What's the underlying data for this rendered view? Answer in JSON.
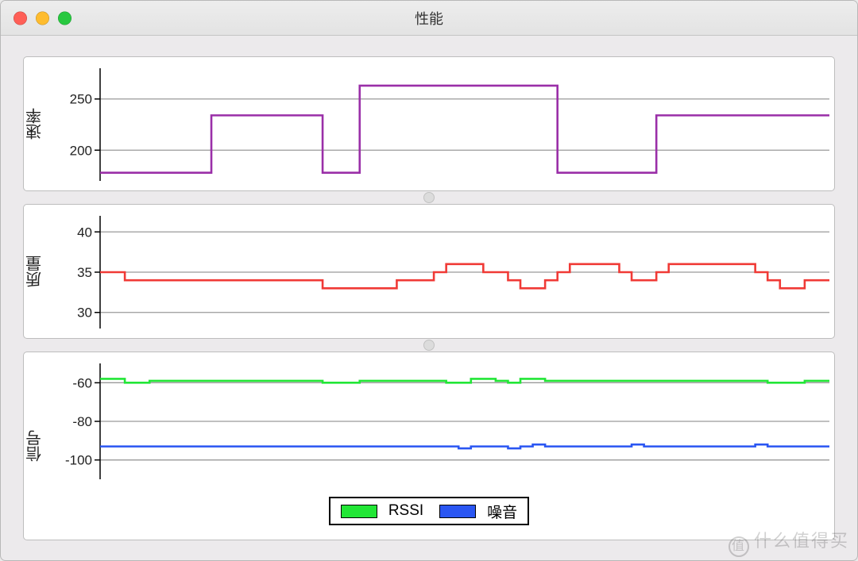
{
  "window_title": "性能",
  "panels": {
    "rate": {
      "label": "速率"
    },
    "quality": {
      "label": "质量"
    },
    "signal": {
      "label": "信号"
    }
  },
  "legend": {
    "rssi": {
      "label": "RSSI",
      "color": "#22e636"
    },
    "noise": {
      "label": "噪音",
      "color": "#2a56f2"
    }
  },
  "colors": {
    "rate_line": "#9a2fa8",
    "quality_line": "#f03a36",
    "rssi_line": "#22e636",
    "noise_line": "#2a56f2",
    "grid": "#9a9a9a"
  },
  "watermark": "什么值得买",
  "chart_data": [
    {
      "type": "line",
      "title": "速率",
      "xlabel": "",
      "ylabel": "速率",
      "ylim": [
        170,
        280
      ],
      "yticks": [
        200,
        250
      ],
      "x_range": [
        0,
        59
      ],
      "series": [
        {
          "name": "速率",
          "color": "#9a2fa8",
          "values": [
            178,
            178,
            178,
            178,
            178,
            178,
            178,
            178,
            178,
            234,
            234,
            234,
            234,
            234,
            234,
            234,
            234,
            234,
            178,
            178,
            178,
            263,
            263,
            263,
            263,
            263,
            263,
            263,
            263,
            263,
            263,
            263,
            263,
            263,
            263,
            263,
            263,
            178,
            178,
            178,
            178,
            178,
            178,
            178,
            178,
            234,
            234,
            234,
            234,
            234,
            234,
            234,
            234,
            234,
            234,
            234,
            234,
            234,
            234,
            234
          ]
        }
      ]
    },
    {
      "type": "line",
      "title": "质量",
      "xlabel": "",
      "ylabel": "质量",
      "ylim": [
        28,
        42
      ],
      "yticks": [
        30,
        35,
        40
      ],
      "x_range": [
        0,
        59
      ],
      "series": [
        {
          "name": "质量",
          "color": "#f03a36",
          "values": [
            35,
            35,
            34,
            34,
            34,
            34,
            34,
            34,
            34,
            34,
            34,
            34,
            34,
            34,
            34,
            34,
            34,
            34,
            33,
            33,
            33,
            33,
            33,
            33,
            34,
            34,
            34,
            35,
            36,
            36,
            36,
            35,
            35,
            34,
            33,
            33,
            34,
            35,
            36,
            36,
            36,
            36,
            35,
            34,
            34,
            35,
            36,
            36,
            36,
            36,
            36,
            36,
            36,
            35,
            34,
            33,
            33,
            34,
            34,
            34
          ]
        }
      ]
    },
    {
      "type": "line",
      "title": "信号",
      "xlabel": "",
      "ylabel": "信号",
      "ylim": [
        -110,
        -50
      ],
      "yticks": [
        -100,
        -80,
        -60
      ],
      "x_range": [
        0,
        59
      ],
      "legend_position": "bottom",
      "series": [
        {
          "name": "RSSI",
          "color": "#22e636",
          "values": [
            -58,
            -58,
            -60,
            -60,
            -59,
            -59,
            -59,
            -59,
            -59,
            -59,
            -59,
            -59,
            -59,
            -59,
            -59,
            -59,
            -59,
            -59,
            -60,
            -60,
            -60,
            -59,
            -59,
            -59,
            -59,
            -59,
            -59,
            -59,
            -60,
            -60,
            -58,
            -58,
            -59,
            -60,
            -58,
            -58,
            -59,
            -59,
            -59,
            -59,
            -59,
            -59,
            -59,
            -59,
            -59,
            -59,
            -59,
            -59,
            -59,
            -59,
            -59,
            -59,
            -59,
            -59,
            -60,
            -60,
            -60,
            -59,
            -59,
            -59
          ]
        },
        {
          "name": "噪音",
          "color": "#2a56f2",
          "values": [
            -93,
            -93,
            -93,
            -93,
            -93,
            -93,
            -93,
            -93,
            -93,
            -93,
            -93,
            -93,
            -93,
            -93,
            -93,
            -93,
            -93,
            -93,
            -93,
            -93,
            -93,
            -93,
            -93,
            -93,
            -93,
            -93,
            -93,
            -93,
            -93,
            -94,
            -93,
            -93,
            -93,
            -94,
            -93,
            -92,
            -93,
            -93,
            -93,
            -93,
            -93,
            -93,
            -93,
            -92,
            -93,
            -93,
            -93,
            -93,
            -93,
            -93,
            -93,
            -93,
            -93,
            -92,
            -93,
            -93,
            -93,
            -93,
            -93,
            -93
          ]
        }
      ]
    }
  ]
}
